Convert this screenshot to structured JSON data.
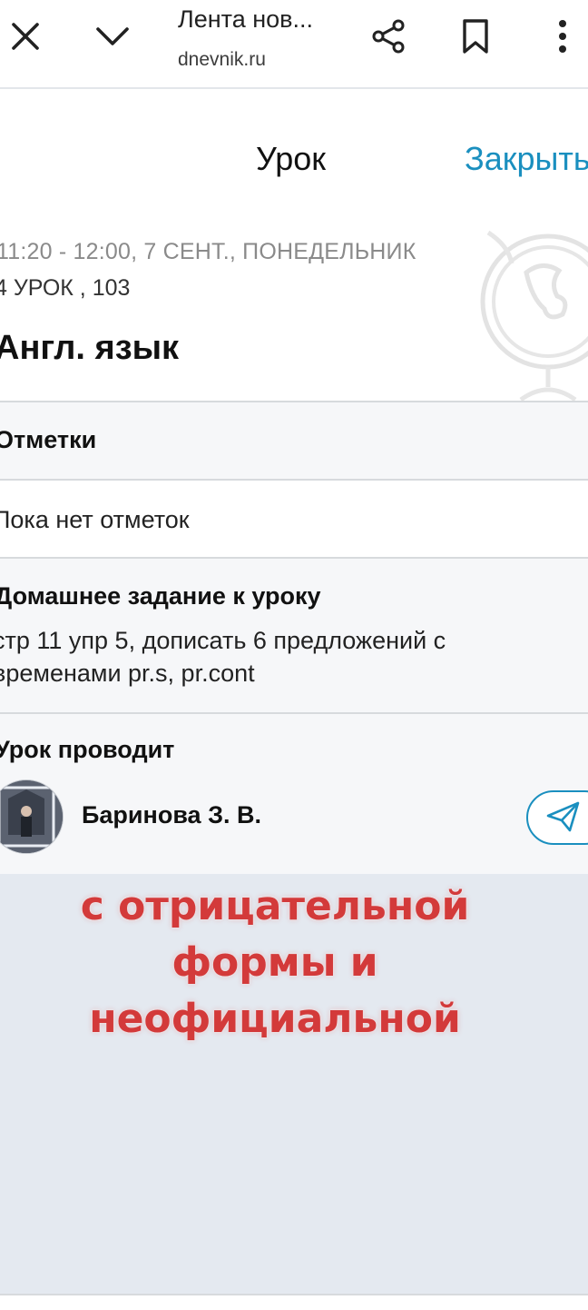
{
  "browser": {
    "title": "Лента нов...",
    "url": "dnevnik.ru",
    "icons": [
      "close-icon",
      "chevron-down-icon",
      "share-icon",
      "bookmark-icon",
      "more-vert-icon"
    ]
  },
  "header": {
    "title": "Урок",
    "close_label": "Закрыть"
  },
  "lesson": {
    "time": "11:20 - 12:00, 7 СЕНТ., ПОНЕДЕЛЬНИК",
    "number_room": "4 УРОК , 103",
    "subject": "Англ. язык"
  },
  "grades": {
    "label": "Отметки",
    "empty_text": "Пока нет отметок"
  },
  "homework": {
    "label": "Домашнее задание к уроку",
    "lines": [
      "стр 11 упр 5, дописать 6 предложений с",
      "временами pr.s, pr.cont"
    ]
  },
  "teacher": {
    "label": "Урок проводит",
    "name": "Баринова З. В."
  },
  "overlay": {
    "lines": [
      "с отрицательной",
      "формы и",
      "неофициальной"
    ],
    "color": "#d33a3a"
  },
  "colors": {
    "accent": "#1a8fbf",
    "section_bg": "#f6f7f9",
    "lower_bg": "#e4e9f0"
  }
}
